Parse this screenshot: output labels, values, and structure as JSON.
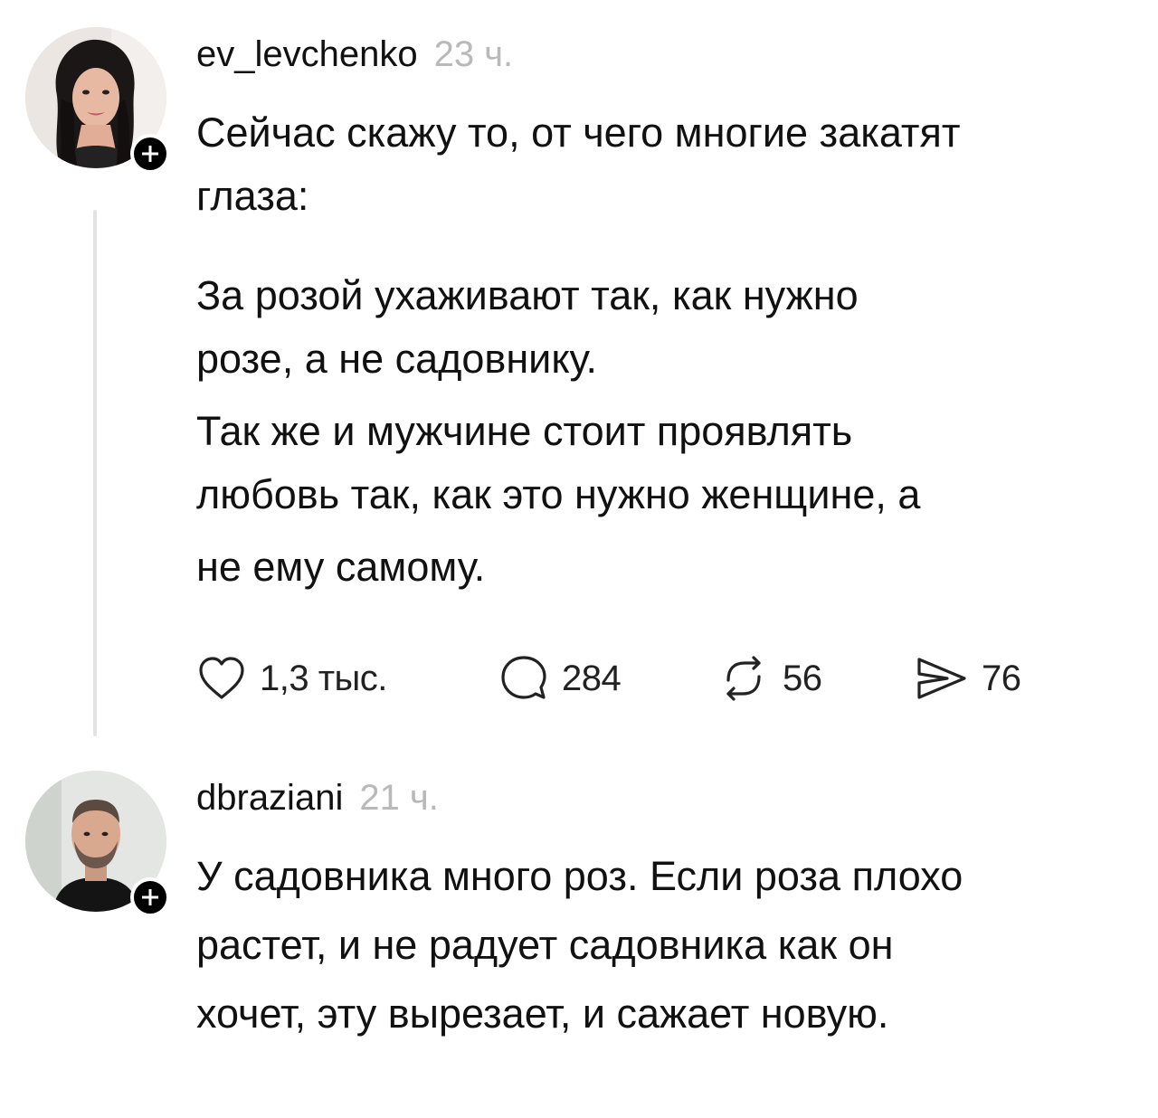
{
  "posts": [
    {
      "username": "ev_levchenko",
      "time": "23 ч.",
      "text_lines": [
        "Сейчас скажу то, от чего многие закатят",
        "глаза:",
        "",
        "За розой ухаживают так, как нужно",
        "розе, а не садовнику.",
        "Так же и мужчине стоит проявлять",
        "любовь так, как это нужно женщине, а",
        "не ему самому."
      ],
      "actions": {
        "likes": "1,3 тыс.",
        "replies": "284",
        "reposts": "56",
        "shares": "76"
      }
    },
    {
      "username": "dbraziani",
      "time": "21 ч.",
      "text_lines": [
        "У садовника много роз. Если роза плохо",
        "растет, и не радует садовника как он",
        "хочет, эту вырезает, и сажает новую."
      ]
    }
  ],
  "icons": {
    "like": "heart-icon",
    "reply": "comment-icon",
    "repost": "repost-icon",
    "share": "send-icon",
    "follow": "plus-icon"
  },
  "colors": {
    "text": "#111111",
    "timestamp": "#b9b9b9",
    "thread_line": "#e3e3e3",
    "badge": "#000000"
  }
}
